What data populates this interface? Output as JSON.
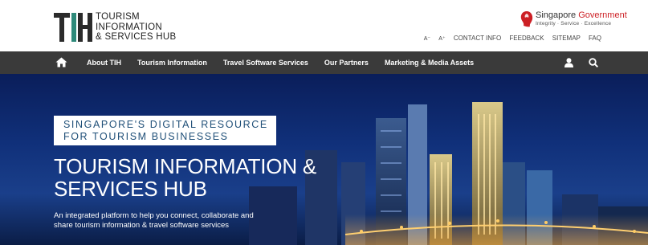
{
  "header": {
    "logo_mark": "TIH",
    "logo_lines": [
      "TOURISM",
      "INFORMATION",
      "& SERVICES HUB"
    ],
    "gov": {
      "title_part1": "Singapore",
      "title_part2": "Government",
      "subtitle": "Integrity · Service · Excellence"
    },
    "utility_links": {
      "font_small": "A⁻",
      "font_large": "A⁺",
      "contact": "CONTACT INFO",
      "feedback": "FEEDBACK",
      "sitemap": "SITEMAP",
      "faq": "FAQ"
    }
  },
  "nav": {
    "items": [
      "About TIH",
      "Tourism Information",
      "Travel Software Services",
      "Our Partners",
      "Marketing & Media Assets"
    ]
  },
  "hero": {
    "badge_lines": [
      "SINGAPORE'S DIGITAL RESOURCE",
      "FOR TOURISM BUSINESSES"
    ],
    "title_lines": [
      "TOURISM INFORMATION &",
      "SERVICES HUB"
    ],
    "description_lines": [
      "An integrated platform to help you connect, collaborate and",
      "share tourism information & travel software services"
    ]
  },
  "colors": {
    "nav_bg": "#3a3a3a",
    "gov_red": "#cc1f24",
    "badge_text": "#1f4f78",
    "hero_sky": "#10307a"
  },
  "icons": [
    "home-icon",
    "user-icon",
    "search-icon",
    "singapore-lion-icon"
  ]
}
